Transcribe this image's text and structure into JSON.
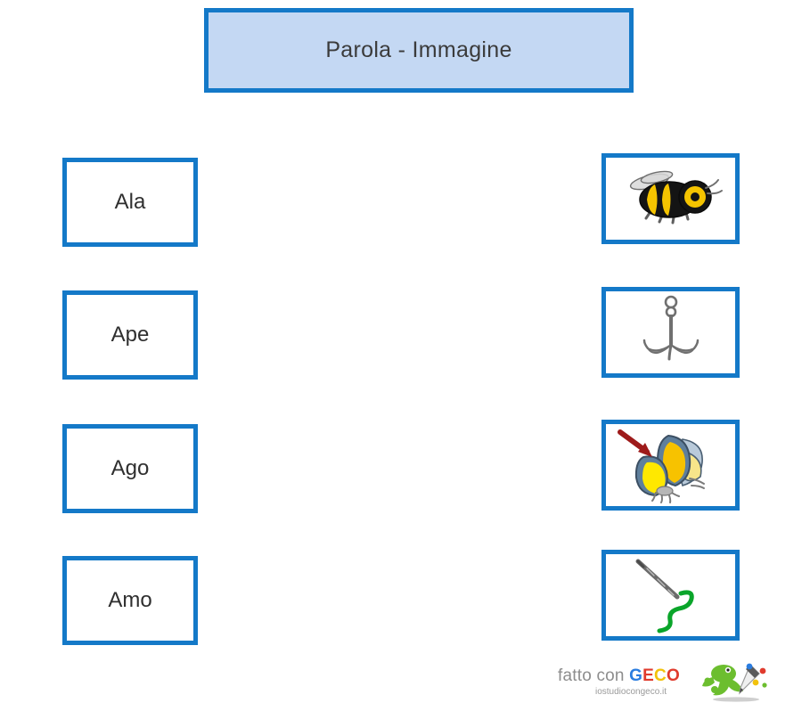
{
  "title": {
    "text": "Parola - Immagine"
  },
  "colors": {
    "border_blue": "#1479c8",
    "title_fill": "#c4d8f3",
    "card_fill": "#ffffff",
    "text": "#2f2f2f",
    "page_background": "#ffffff",
    "bee_yellow": "#f5c400",
    "bee_black": "#121212",
    "hook_grey": "#707070",
    "butterfly_yellow": "#ffe800",
    "butterfly_gold": "#f7c200",
    "butterfly_blue": "#6d8ba8",
    "arrow_red": "#9e1b1b",
    "thread_green": "#0aa52a",
    "needle_grey": "#6b6b6b",
    "geco_blue": "#2b7de0",
    "geco_red": "#e03b2d",
    "geco_yellow": "#f2c20c",
    "geco_green": "#6cbe2f"
  },
  "words": [
    {
      "label": "Ala"
    },
    {
      "label": "Ape"
    },
    {
      "label": "Ago"
    },
    {
      "label": "Amo"
    }
  ],
  "images": [
    {
      "icon": "bee-icon"
    },
    {
      "icon": "fishhook-icon"
    },
    {
      "icon": "butterfly-wing-icon"
    },
    {
      "icon": "needle-thread-icon"
    }
  ],
  "footer": {
    "prefix": "fatto con",
    "brand_g": "G",
    "brand_e": "E",
    "brand_c": "C",
    "brand_o": "O",
    "website": "iostudiocongeco.it",
    "mascot": "gecko-mascot-icon"
  }
}
